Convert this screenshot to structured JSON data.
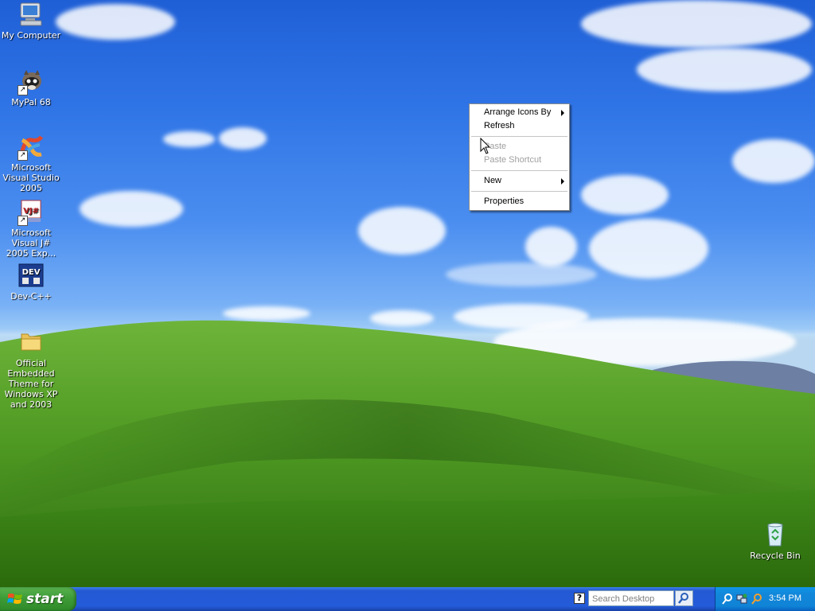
{
  "desktop": {
    "icons": [
      {
        "label": "My Computer",
        "icon": "my-computer-icon"
      },
      {
        "label": "MyPal 68",
        "icon": "mypal-icon"
      },
      {
        "label": "Microsoft Visual Studio 2005",
        "icon": "visual-studio-icon"
      },
      {
        "label": "Microsoft Visual J# 2005 Exp...",
        "icon": "visual-jsharp-icon",
        "badge": "VJ#"
      },
      {
        "label": "Dev-C++",
        "icon": "dev-cpp-icon",
        "badge": "DEV"
      },
      {
        "label": "Official Embedded Theme for Windows XP and 2003",
        "icon": "folder-icon"
      },
      {
        "label": "Recycle Bin",
        "icon": "recycle-bin-icon"
      }
    ]
  },
  "context_menu": {
    "items": [
      {
        "label": "Arrange Icons By",
        "submenu": true,
        "enabled": true
      },
      {
        "label": "Refresh",
        "submenu": false,
        "enabled": true
      },
      {
        "label": "Paste",
        "submenu": false,
        "enabled": false
      },
      {
        "label": "Paste Shortcut",
        "submenu": false,
        "enabled": false
      },
      {
        "label": "New",
        "submenu": true,
        "enabled": true
      },
      {
        "label": "Properties",
        "submenu": false,
        "enabled": true
      }
    ]
  },
  "taskbar": {
    "start_label": "start",
    "help_label": "?",
    "search_placeholder": "Search Desktop",
    "clock": "3:54 PM"
  },
  "colors": {
    "taskbar_blue": "#245bd9",
    "start_green": "#3c9a35",
    "tray_blue": "#1083d6"
  }
}
